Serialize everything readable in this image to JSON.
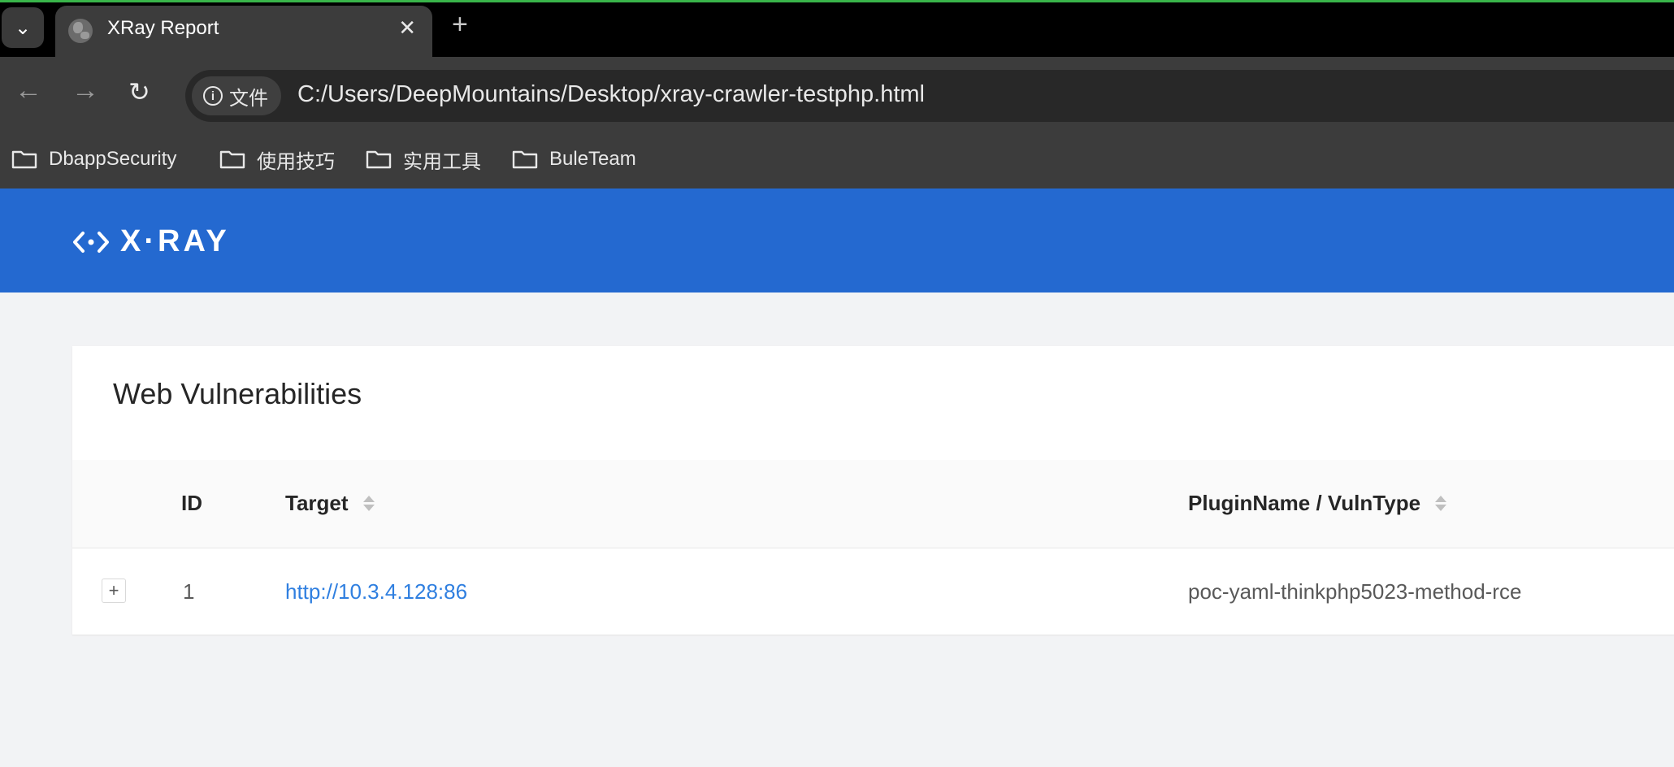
{
  "browser": {
    "tab": {
      "title": "XRay Report",
      "close_glyph": "✕"
    },
    "new_tab_glyph": "+",
    "site_chip_label": "文件",
    "url": "C:/Users/DeepMountains/Desktop/xray-crawler-testphp.html",
    "bookmarks": [
      {
        "label": "DbappSecurity",
        "icon": "folder-icon"
      },
      {
        "label": "使用技巧",
        "icon": "folder-icon"
      },
      {
        "label": "实用工具",
        "icon": "folder-icon"
      },
      {
        "label": "BuleTeam",
        "icon": "folder-icon"
      }
    ],
    "colors": {
      "tabstrip": "#000000",
      "toolbar": "#3c3c3c",
      "accent_line": "#39b54a"
    }
  },
  "header": {
    "logo_text": "X·RAY",
    "background": "#2469d0"
  },
  "report": {
    "section_title": "Web Vulnerabilities",
    "columns": [
      "ID",
      "Target",
      "PluginName / VulnType"
    ],
    "rows": [
      {
        "id": "1",
        "target": "http://10.3.4.128:86",
        "plugin": "poc-yaml-thinkphp5023-method-rce",
        "expand_glyph": "+"
      }
    ],
    "link_color": "#2f7fe0"
  }
}
